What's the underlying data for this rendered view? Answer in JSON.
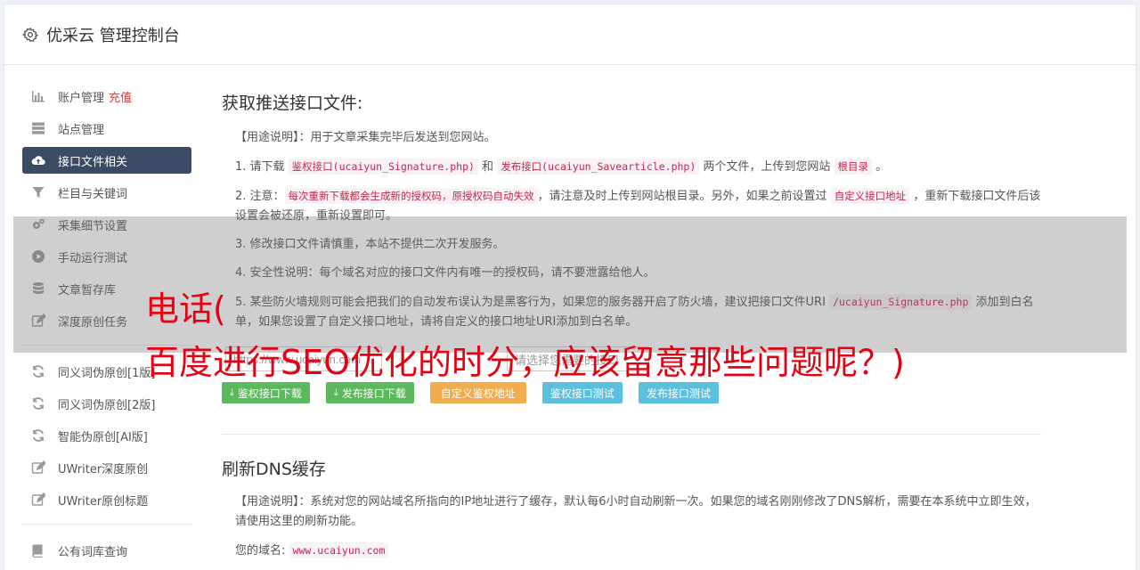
{
  "header": {
    "title": "优采云 管理控制台",
    "icon": "gear-icon"
  },
  "sidebar": {
    "items": [
      {
        "label": "账户管理",
        "extra": "充值",
        "icon": "bar-chart-icon"
      },
      {
        "label": "站点管理",
        "icon": "server-icon"
      },
      {
        "label": "接口文件相关",
        "icon": "cloud-upload-icon",
        "active": true
      },
      {
        "label": "栏目与关键词",
        "icon": "filter-icon"
      },
      {
        "label": "采集细节设置",
        "icon": "cogs-icon"
      },
      {
        "label": "手动运行测试",
        "icon": "play-icon"
      },
      {
        "label": "文章暂存库",
        "icon": "database-icon"
      },
      {
        "label": "深度原创任务",
        "icon": "edit-icon"
      },
      {
        "label": "同义词伪原创[1版]",
        "icon": "refresh-icon"
      },
      {
        "label": "同义词伪原创[2版]",
        "icon": "refresh-icon"
      },
      {
        "label": "智能伪原创[AI版]",
        "icon": "refresh-icon"
      },
      {
        "label": "UWriter深度原创",
        "icon": "edit-icon"
      },
      {
        "label": "UWriter原创标题",
        "icon": "edit-icon"
      },
      {
        "label": "公有词库查询",
        "icon": "book-icon"
      }
    ]
  },
  "section1": {
    "title": "获取推送接口文件:",
    "usage_label": "【用途说明】",
    "usage_text": "：用于文章采集完毕后发送到您网站。",
    "step1_a": "1. 请下载 ",
    "step1_code1": "鉴权接口(ucaiyun_Signature.php)",
    "step1_b": " 和 ",
    "step1_code2": "发布接口(ucaiyun_Savearticle.php)",
    "step1_c": " 两个文件，上传到您网站 ",
    "step1_code3": "根目录",
    "step1_d": " 。",
    "step2_a": "2. 注意：",
    "step2_code1": "每次重新下载都会生成新的授权码，原授权码自动失效",
    "step2_b": "，请注意及时上传到网站根目录。另外，如果之前设置过 ",
    "step2_code2": "自定义接口地址",
    "step2_c": " ，重新下载接口文件后该设置会被还原，重新设置即可。",
    "step3": "3. 修改接口文件请慎重，本站不提供二次开发服务。",
    "step4": "4. 安全性说明：每个域名对应的接口文件内有唯一的授权码，请不要泄露给他人。",
    "step5_a": "5. 某些防火墙规则可能会把我们的自动发布误认为是黑客行为，如果您的服务器开启了防火墙，建议把接口文件URI ",
    "step5_code": "/ucaiyun_Signature.php",
    "step5_b": " 添加到白名单，如果您设置了自定义接口地址，请将自定义的接口地址URI添加到白名单。",
    "site_input_value": "https://www.ucaiyun.com",
    "select_placeholder": "请选择您需要的接口",
    "buttons": {
      "auth_download": "鉴权接口下载",
      "publish_download": "发布接口下载",
      "custom_auth_url": "自定义鉴权地址",
      "auth_test": "鉴权接口测试",
      "publish_test": "发布接口测试"
    }
  },
  "section2": {
    "title": "刷新DNS缓存",
    "usage_label": "【用途说明】",
    "usage_text": "：系统对您的网站域名所指向的IP地址进行了缓存，默认每6小时自动刷新一次。如果您的域名刚刚修改了DNS解析，需要在本系统中立即生效，请使用这里的刷新功能。",
    "domain_label": "您的域名:",
    "domain_value": "www.ucaiyun.com"
  },
  "overlay": {
    "line1": "电话(",
    "line2": "百度进行SEO优化的时分，应该留意那些问题呢？)"
  },
  "colors": {
    "active_nav": "#3a4b63",
    "green": "#5cb85c",
    "orange": "#f0ad4e",
    "blue": "#5bc0de",
    "overlay_text": "#e60012",
    "code_text": "#c7254e"
  }
}
